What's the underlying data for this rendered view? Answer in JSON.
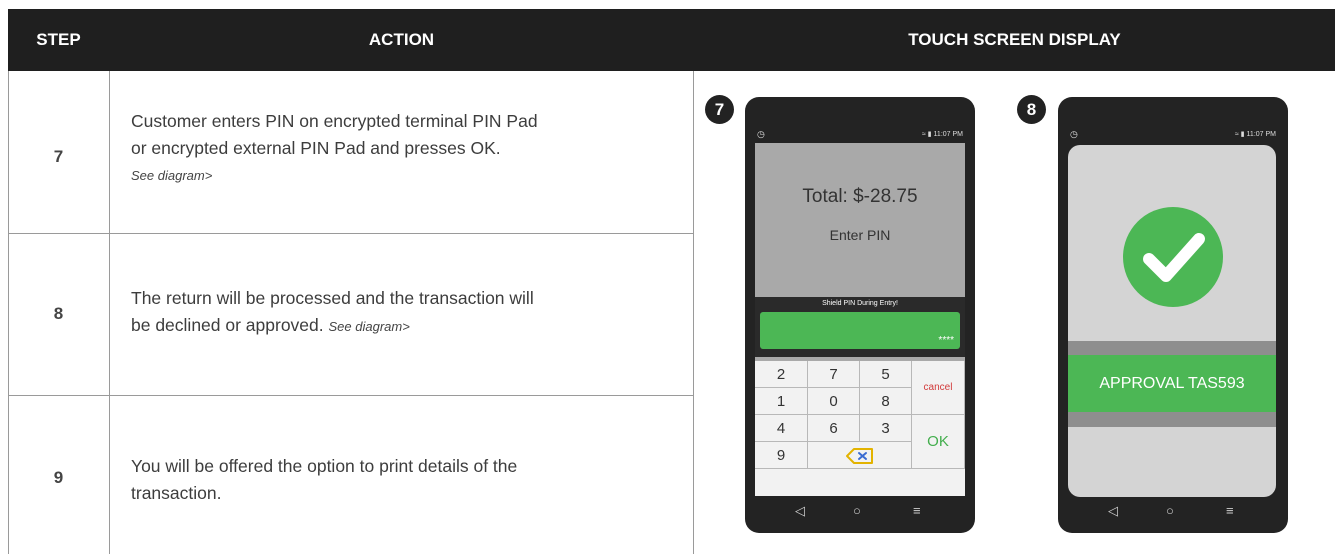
{
  "header": {
    "step": "STEP",
    "action": "ACTION",
    "touch_screen_display": "TOUCH SCREEN DISPLAY"
  },
  "rows": [
    {
      "step": "7",
      "action_line1": "Customer enters PIN on encrypted terminal PIN Pad",
      "action_line2": "or encrypted external PIN Pad and presses OK.",
      "note": "See diagram>"
    },
    {
      "step": "8",
      "action_line1": "The return will be processed and the transaction will",
      "action_line2": "be declined or approved.",
      "note": "See diagram>"
    },
    {
      "step": "9",
      "action_line1": "You will be offered the option to print details of the",
      "action_line2": "transaction.",
      "note": ""
    }
  ],
  "phone7": {
    "badge": "7",
    "time": "11:07 PM",
    "total": "Total: $-28.75",
    "prompt": "Enter PIN",
    "shield_label": "Shield PIN During Entry!",
    "pin_mask": "****",
    "keys": [
      "2",
      "7",
      "5",
      "1",
      "0",
      "8",
      "4",
      "6",
      "3",
      "9"
    ],
    "cancel_label": "cancel",
    "ok_label": "OK"
  },
  "phone8": {
    "badge": "8",
    "time": "11:07 PM",
    "approval": "APPROVAL TAS593",
    "status_color": "#4cb755"
  },
  "nav_icons": [
    "back-icon",
    "home-icon",
    "menu-icon"
  ],
  "colors": {
    "header_bg": "#1f1f1f",
    "accent_green": "#4cb755",
    "cancel_red": "#d23b3b"
  }
}
